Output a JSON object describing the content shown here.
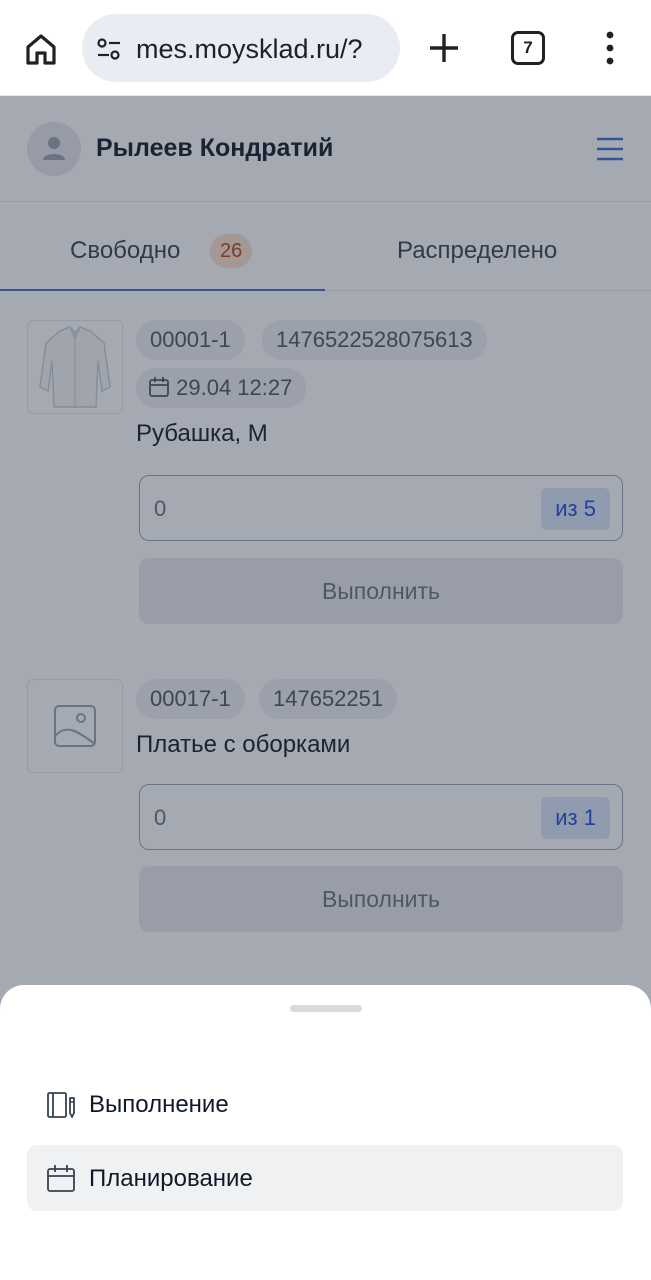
{
  "browser": {
    "url": "mes.moysklad.ru/?",
    "tab_count": "7",
    "icons": [
      "home-icon",
      "site-settings-icon",
      "new-tab-icon",
      "tab-switcher-icon",
      "more-menu-icon"
    ]
  },
  "header": {
    "user_name": "Рылеев Кондратий",
    "icons": [
      "avatar-icon",
      "burger-menu-icon"
    ]
  },
  "tabs": [
    {
      "label": "Свободно",
      "badge": "26",
      "active": true
    },
    {
      "label": "Распределено",
      "active": false
    }
  ],
  "cards": [
    {
      "number": "00001-1",
      "code": "147652252807561З",
      "date": "29.04 12:27",
      "name": "Рубашка, М",
      "qty_value": "0",
      "qty_of": "из 5",
      "button": "Выполнить"
    },
    {
      "number": "00017-1",
      "code": "147652251",
      "name": "Платье с оборками",
      "qty_value": "0",
      "qty_of": "из 1",
      "button": "Выполнить"
    }
  ],
  "sheet": {
    "items": [
      {
        "label": "Выполнение",
        "icon": "execution-icon",
        "active": false
      },
      {
        "label": "Планирование",
        "icon": "calendar-icon",
        "active": true
      }
    ]
  },
  "colors": {
    "accent": "#3b6fd8",
    "badge_bg": "#fde2cf",
    "badge_text": "#c2410c",
    "qty_of_bg": "#dbe7fb",
    "qty_of_text": "#1d4ed8"
  }
}
